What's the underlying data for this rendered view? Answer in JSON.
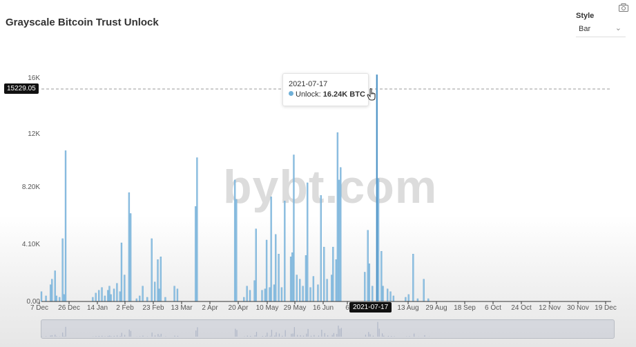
{
  "title": "Grayscale Bitcoin Trust Unlock",
  "style_control": {
    "label": "Style",
    "value": "Bar"
  },
  "icons": {
    "camera": "camera-icon",
    "chevron": "chevron-down-icon",
    "cursor": "hand-pointer-icon"
  },
  "watermark": "bybt.com",
  "tooltip": {
    "date": "2021-07-17",
    "series_label": "Unlock:",
    "value_text": "16.24K BTC"
  },
  "crosshair": {
    "y_label": "15229.05",
    "x_label": "2021-07-17"
  },
  "colors": {
    "bar": "#8fc1e3",
    "bar_edge": "#5a9cc8",
    "dot": "#6fb0d8"
  },
  "chart_data": {
    "type": "bar",
    "series_name": "Unlock",
    "unit": "BTC",
    "x_ticks": [
      "7 Dec",
      "26 Dec",
      "14 Jan",
      "2 Feb",
      "23 Feb",
      "13 Mar",
      "2 Apr",
      "20 Apr",
      "10 May",
      "29 May",
      "16 Jun",
      "6",
      "13 Aug",
      "29 Aug",
      "18 Sep",
      "6 Oct",
      "24 Oct",
      "12 Nov",
      "30 Nov",
      "19 Dec"
    ],
    "y_ticks": [
      "0.00",
      "4.10K",
      "8.20K",
      "12K",
      "16K"
    ],
    "ylim": [
      0,
      16400
    ],
    "grid": false,
    "highlight": {
      "date": "2021-07-17",
      "value": 16240
    },
    "points": [
      [
        "2020-12-07",
        700
      ],
      [
        "2020-12-10",
        400
      ],
      [
        "2020-12-13",
        1200
      ],
      [
        "2020-12-14",
        1600
      ],
      [
        "2020-12-16",
        2200
      ],
      [
        "2020-12-17",
        400
      ],
      [
        "2020-12-19",
        300
      ],
      [
        "2020-12-21",
        4500
      ],
      [
        "2020-12-22",
        500
      ],
      [
        "2020-12-23",
        10800
      ],
      [
        "2021-01-10",
        300
      ],
      [
        "2021-01-12",
        600
      ],
      [
        "2021-01-14",
        800
      ],
      [
        "2021-01-16",
        1000
      ],
      [
        "2021-01-18",
        400
      ],
      [
        "2021-01-20",
        800
      ],
      [
        "2021-01-21",
        1100
      ],
      [
        "2021-01-22",
        500
      ],
      [
        "2021-01-24",
        900
      ],
      [
        "2021-01-26",
        1300
      ],
      [
        "2021-01-28",
        700
      ],
      [
        "2021-01-29",
        4200
      ],
      [
        "2021-01-31",
        1900
      ],
      [
        "2021-02-03",
        7800
      ],
      [
        "2021-02-04",
        6300
      ],
      [
        "2021-02-08",
        200
      ],
      [
        "2021-02-10",
        400
      ],
      [
        "2021-02-12",
        1100
      ],
      [
        "2021-02-15",
        300
      ],
      [
        "2021-02-18",
        4500
      ],
      [
        "2021-02-20",
        1400
      ],
      [
        "2021-02-22",
        3000
      ],
      [
        "2021-02-23",
        900
      ],
      [
        "2021-02-24",
        3200
      ],
      [
        "2021-02-27",
        300
      ],
      [
        "2021-03-05",
        1100
      ],
      [
        "2021-03-07",
        900
      ],
      [
        "2021-03-19",
        6800
      ],
      [
        "2021-03-20",
        10300
      ],
      [
        "2021-04-14",
        8700
      ],
      [
        "2021-04-15",
        7300
      ],
      [
        "2021-04-20",
        300
      ],
      [
        "2021-04-22",
        1100
      ],
      [
        "2021-04-24",
        800
      ],
      [
        "2021-04-27",
        1500
      ],
      [
        "2021-04-28",
        5200
      ],
      [
        "2021-05-02",
        800
      ],
      [
        "2021-05-04",
        900
      ],
      [
        "2021-05-05",
        4400
      ],
      [
        "2021-05-07",
        1000
      ],
      [
        "2021-05-08",
        7500
      ],
      [
        "2021-05-10",
        1200
      ],
      [
        "2021-05-11",
        4800
      ],
      [
        "2021-05-13",
        3400
      ],
      [
        "2021-05-15",
        1000
      ],
      [
        "2021-05-17",
        7200
      ],
      [
        "2021-05-21",
        3200
      ],
      [
        "2021-05-22",
        3500
      ],
      [
        "2021-05-23",
        10500
      ],
      [
        "2021-05-25",
        1900
      ],
      [
        "2021-05-27",
        1600
      ],
      [
        "2021-05-29",
        1100
      ],
      [
        "2021-05-31",
        3300
      ],
      [
        "2021-06-01",
        8500
      ],
      [
        "2021-06-03",
        1000
      ],
      [
        "2021-06-05",
        1800
      ],
      [
        "2021-06-08",
        1200
      ],
      [
        "2021-06-10",
        7600
      ],
      [
        "2021-06-12",
        3900
      ],
      [
        "2021-06-14",
        1600
      ],
      [
        "2021-06-17",
        1900
      ],
      [
        "2021-06-18",
        3900
      ],
      [
        "2021-06-20",
        3000
      ],
      [
        "2021-06-21",
        12100
      ],
      [
        "2021-06-22",
        8700
      ],
      [
        "2021-06-23",
        9600
      ],
      [
        "2021-07-09",
        2100
      ],
      [
        "2021-07-11",
        5100
      ],
      [
        "2021-07-12",
        2700
      ],
      [
        "2021-07-14",
        1100
      ],
      [
        "2021-07-17",
        16240
      ],
      [
        "2021-07-18",
        8800
      ],
      [
        "2021-07-20",
        3600
      ],
      [
        "2021-07-21",
        1100
      ],
      [
        "2021-07-24",
        900
      ],
      [
        "2021-07-26",
        700
      ],
      [
        "2021-07-28",
        400
      ],
      [
        "2021-08-05",
        300
      ],
      [
        "2021-08-07",
        500
      ],
      [
        "2021-08-10",
        3400
      ],
      [
        "2021-08-13",
        200
      ],
      [
        "2021-08-17",
        1600
      ],
      [
        "2021-08-20",
        200
      ]
    ]
  }
}
